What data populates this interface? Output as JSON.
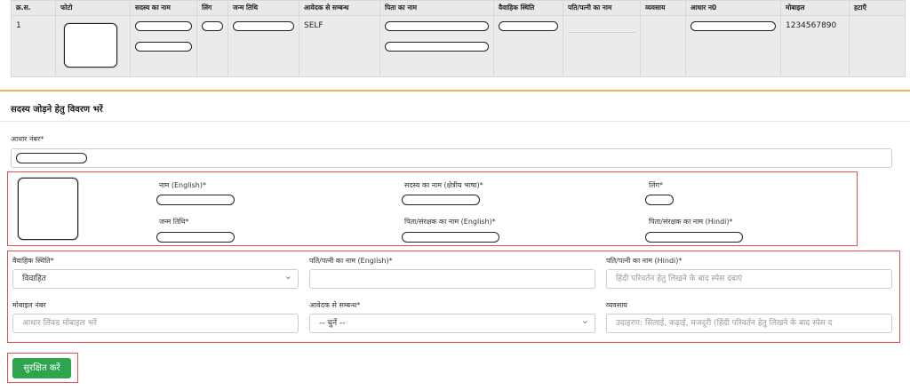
{
  "members_table": {
    "columns": [
      "क्र.स.",
      "फोटो",
      "सदस्य का नाम",
      "लिंग",
      "जन्म तिथि",
      "आवेदक से सम्बन्ध",
      "पिता का नाम",
      "वैवाहिक स्थिति",
      "पति/पत्नी का नाम",
      "व्यवसाय",
      "आधार न0",
      "मोबाइल",
      "हटाएँ"
    ],
    "rows": [
      {
        "serial": "1",
        "relation": "SELF",
        "mobile": "1234567890"
      }
    ]
  },
  "form": {
    "title": "सदस्य जोड़ने हेतु विवरण भरें",
    "aadhaar_label": "आधार नंबर*",
    "name_english_label": "नाम (English)*",
    "name_regional_label": "सदस्य का नाम (क्षेत्रीय भाषा)*",
    "gender_label": "लिंग*",
    "dob_label": "जन्म तिथि*",
    "father_english_label": "पिता/संरक्षक का नाम (English)*",
    "father_hindi_label": "पिता/संरक्षक का नाम (Hindi)*",
    "marital_label": "वैवाहिक स्थिति*",
    "marital_value": "विवाहित",
    "spouse_english_label": "पति/पत्नी का नाम (English)*",
    "spouse_hindi_label": "पति/पत्नी का नाम (Hindi)*",
    "spouse_hindi_placeholder": "हिंदी परिवर्तन हेतु लिखने के बाद स्पेस दबाएं",
    "mobile_label": "मोबाइल नंबर",
    "mobile_placeholder": "आधार लिंक्ड मोबाइल भरें",
    "relation_label": "आवेदक से सम्बन्ध*",
    "relation_value": "-- चुनें --",
    "occupation_label": "व्यवसाय",
    "occupation_placeholder": "उदाहरण: सिलाई, कढ़ाई, मजदूरी (हिंदी परिवर्तन हेतु लिखने के बाद स्पेस द",
    "save_label": "सुरक्षित करें"
  },
  "colors": {
    "accent": "#e8b64a",
    "highlight": "#e05252",
    "button": "#2ea44f"
  }
}
